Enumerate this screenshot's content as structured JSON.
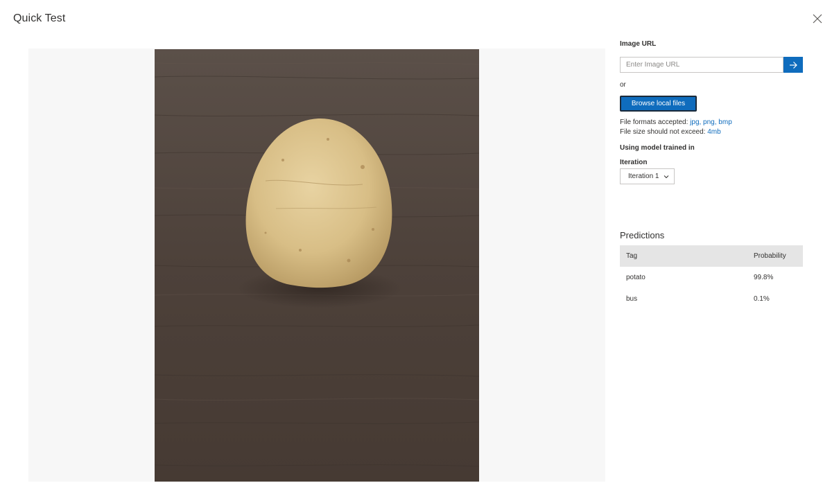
{
  "dialog": {
    "title": "Quick Test"
  },
  "image_url": {
    "label": "Image URL",
    "placeholder": "Enter Image URL",
    "value": ""
  },
  "or_text": "or",
  "browse": {
    "label": "Browse local files"
  },
  "file_info": {
    "formats_prefix": "File formats accepted:",
    "formats": "jpg, png, bmp",
    "size_prefix": "File size should not exceed:",
    "size": "4mb"
  },
  "model": {
    "label": "Using model trained in",
    "iteration_label": "Iteration",
    "iteration_selected": "Iteration 1"
  },
  "predictions": {
    "title": "Predictions",
    "columns": [
      "Tag",
      "Probability"
    ],
    "rows": [
      {
        "tag": "potato",
        "probability": "99.8%"
      },
      {
        "tag": "bus",
        "probability": "0.1%"
      }
    ]
  },
  "colors": {
    "accent": "#0f6cbd",
    "table_header_bg": "#e5e5e5",
    "image_area_bg": "#f7f7f7",
    "wood_table": "#4a3e36",
    "potato": "#d9c08a"
  },
  "icons": {
    "close": "close-icon",
    "go": "arrow-right-icon",
    "dropdown": "chevron-down-icon"
  }
}
